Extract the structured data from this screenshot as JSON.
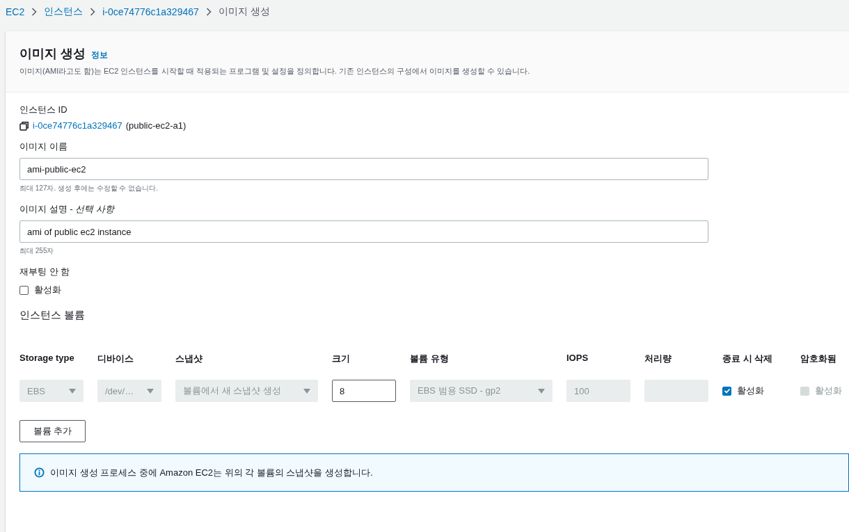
{
  "breadcrumb": [
    {
      "label": "EC2",
      "link": true
    },
    {
      "label": "인스턴스",
      "link": true
    },
    {
      "label": "i-0ce74776c1a329467",
      "link": true
    },
    {
      "label": "이미지 생성",
      "link": false
    }
  ],
  "header": {
    "title": "이미지 생성",
    "info": "정보",
    "description": "이미지(AMI라고도 함)는 EC2 인스턴스를 시작할 때 적용되는 프로그램 및 설정을 정의합니다. 기존 인스턴스의 구성에서 이미지를 생성할 수 있습니다."
  },
  "instance": {
    "label": "인스턴스 ID",
    "id": "i-0ce74776c1a329467",
    "name": "(public-ec2-a1)"
  },
  "image_name": {
    "label": "이미지 이름",
    "value": "ami-public-ec2",
    "hint": "최대 127자. 생성 후에는 수정할 수 없습니다."
  },
  "image_description": {
    "label": "이미지 설명 - *선택 사항*",
    "value": "ami of public ec2 instance",
    "hint": "최대 255자"
  },
  "no_reboot": {
    "label": "재부팅 안 함",
    "option": "활성화",
    "checked": false
  },
  "volumes": {
    "title": "인스턴스 볼륨",
    "columns": [
      {
        "header": "Storage type",
        "cell": {
          "kind": "select",
          "value": "EBS",
          "disabled": true
        }
      },
      {
        "header": "디바이스",
        "cell": {
          "kind": "select",
          "value": "/dev/…",
          "disabled": true
        }
      },
      {
        "header": "스냅샷",
        "cell": {
          "kind": "select",
          "value": "볼륨에서 새 스냅샷 생성",
          "disabled": true
        }
      },
      {
        "header": "크기",
        "cell": {
          "kind": "input",
          "value": "8",
          "disabled": false
        }
      },
      {
        "header": "볼륨 유형",
        "cell": {
          "kind": "select",
          "value": "EBS 범용 SSD - gp2",
          "disabled": true
        }
      },
      {
        "header": "IOPS",
        "cell": {
          "kind": "input",
          "value": "100",
          "disabled": true
        }
      },
      {
        "header": "처리량",
        "cell": {
          "kind": "input",
          "disabled": true
        }
      },
      {
        "header": "종료 시 삭제",
        "cell": {
          "kind": "checkbox",
          "label": "활성화",
          "checked": true,
          "disabled": false
        }
      },
      {
        "header": "암호화됨",
        "cell": {
          "kind": "checkbox",
          "label": "활성화",
          "checked": false,
          "disabled": true
        }
      }
    ],
    "add_button": "볼륨 추가"
  },
  "info_alert": "이미지 생성 프로세스 중에 Amazon EC2는 위의 각 볼륨의 스냅샷을 생성합니다."
}
